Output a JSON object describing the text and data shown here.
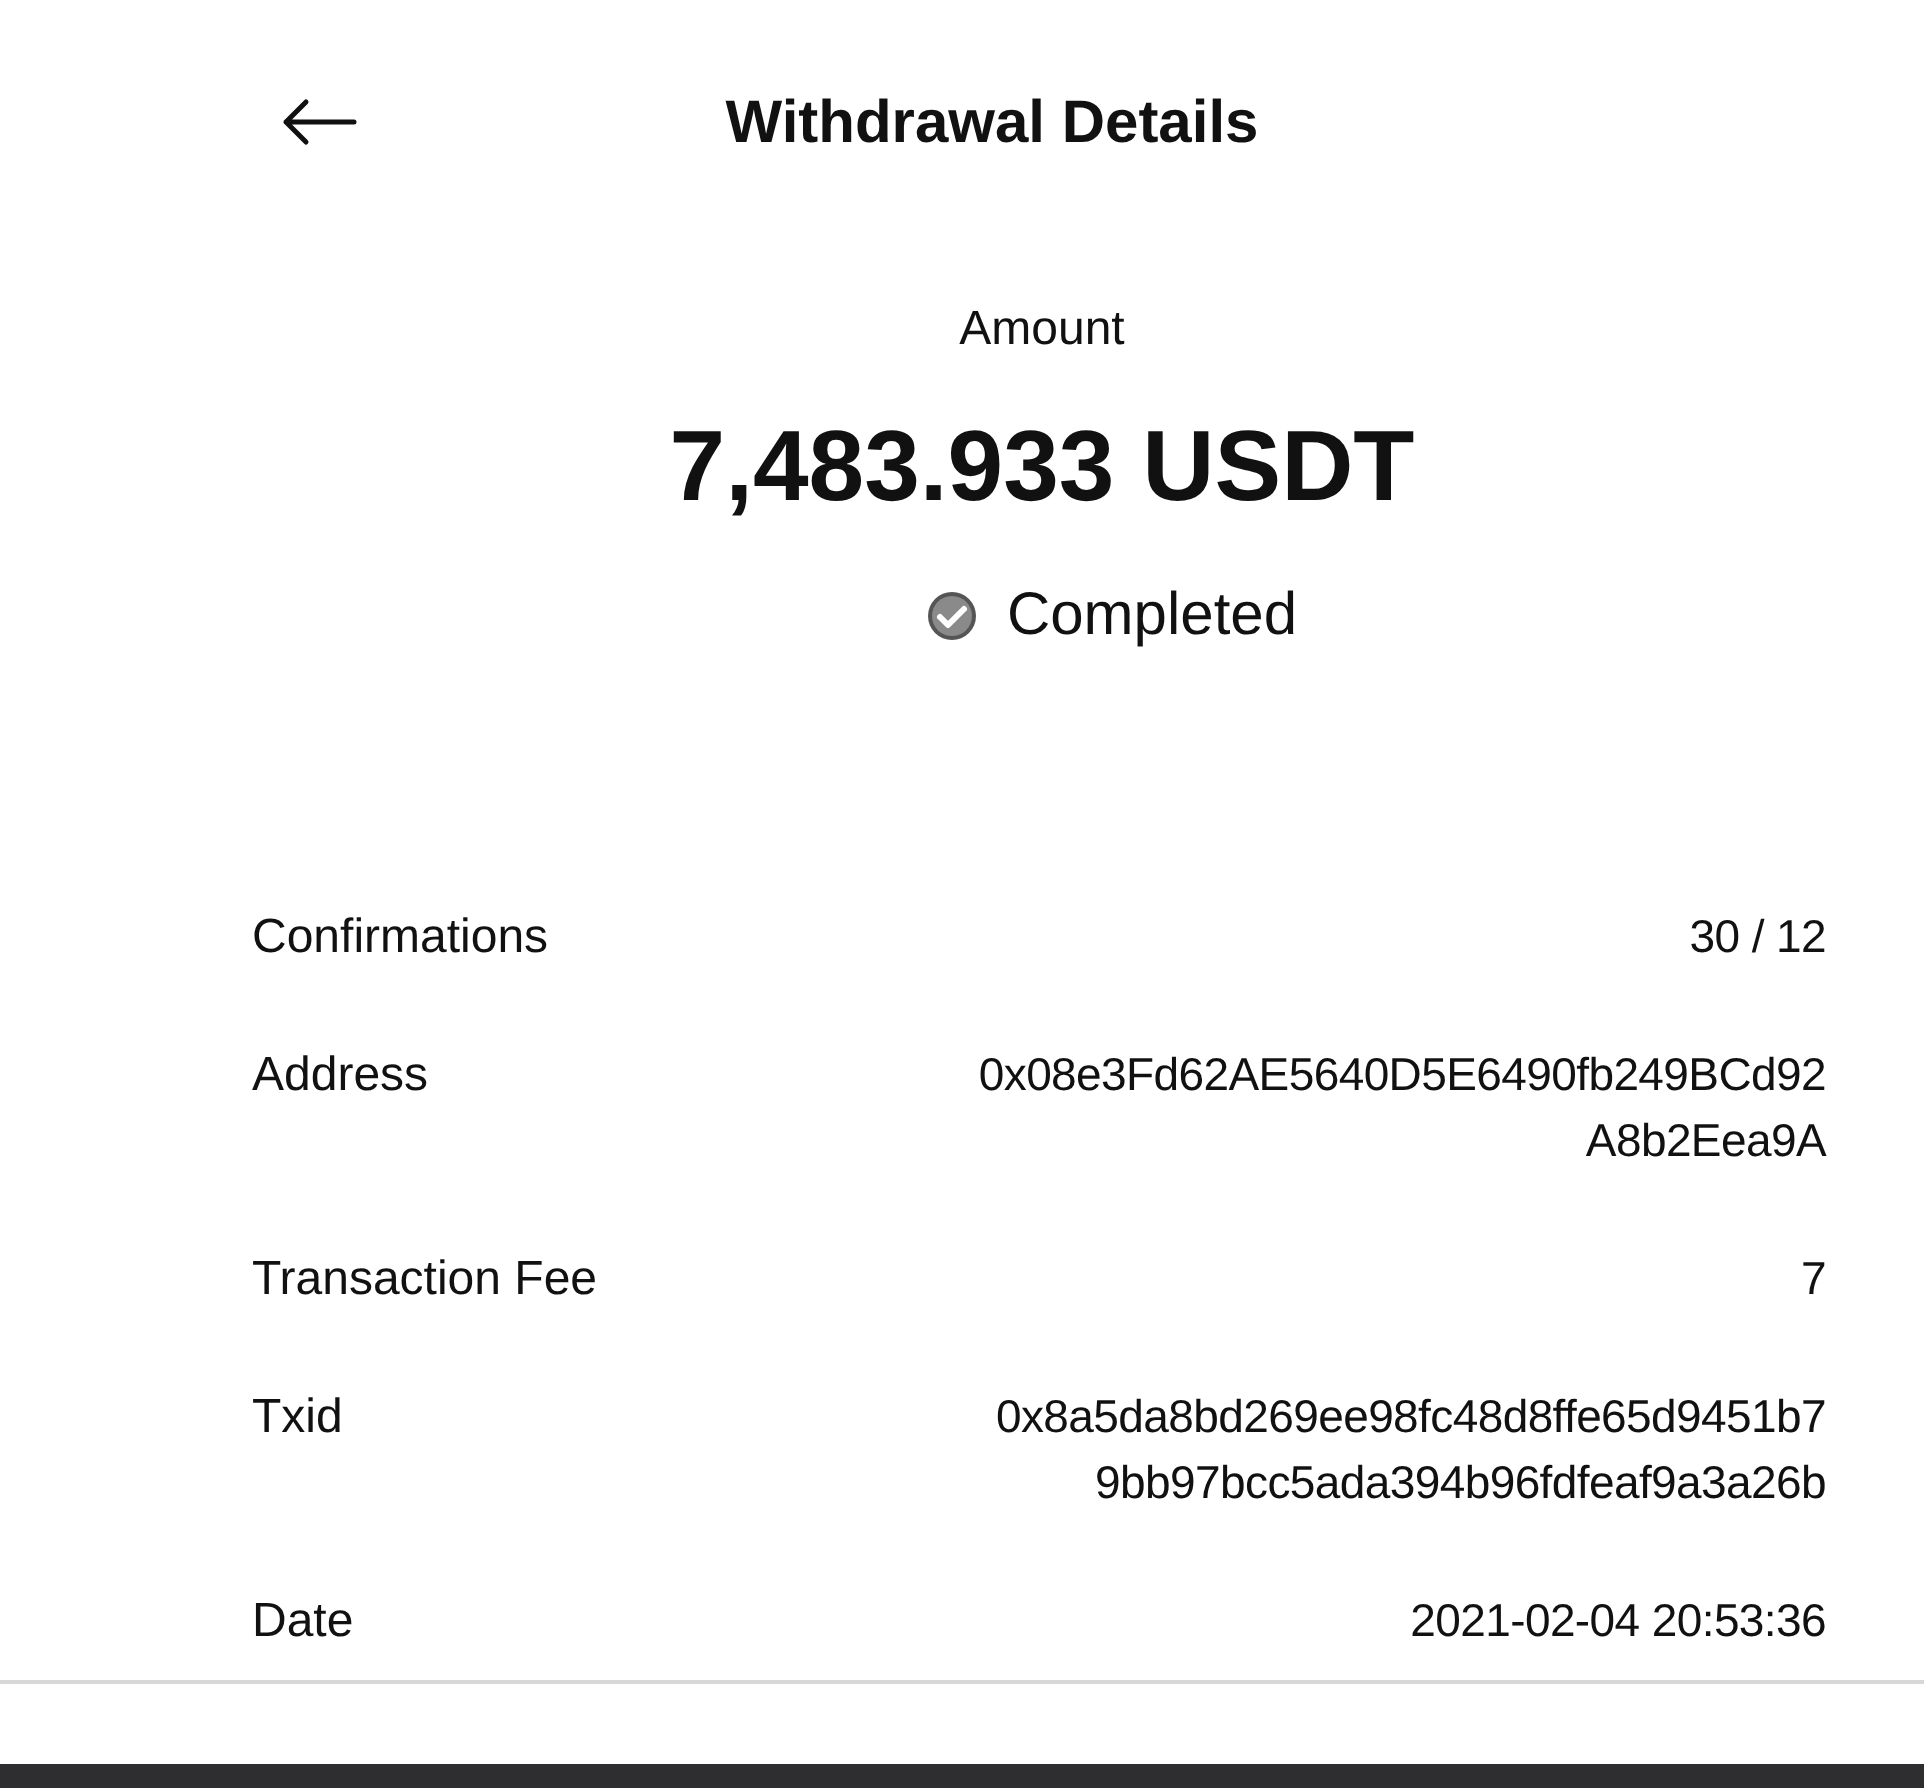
{
  "header": {
    "title": "Withdrawal Details"
  },
  "summary": {
    "label": "Amount",
    "amount": "7,483.933 USDT",
    "status": {
      "kind": "completed",
      "label": "Completed"
    }
  },
  "details": [
    {
      "label": "Confirmations",
      "value_lines": [
        "30 / 12"
      ]
    },
    {
      "label": "Address",
      "value_lines": [
        "0x08e3Fd62AE5640D5E6490fb249BCd92",
        "A8b2Eea9A"
      ]
    },
    {
      "label": "Transaction Fee",
      "value_lines": [
        "7"
      ]
    },
    {
      "label": "Txid",
      "value_lines": [
        "0x8a5da8bd269ee98fc48d8ffe65d9451b7",
        "9bb97bcc5ada394b96fdfeaf9a3a26b"
      ]
    },
    {
      "label": "Date",
      "value_lines": [
        "2021-02-04 20:53:36"
      ]
    }
  ]
}
